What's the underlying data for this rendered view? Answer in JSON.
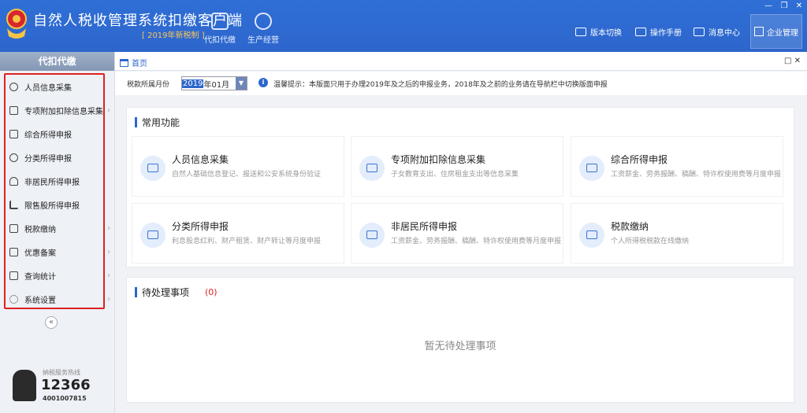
{
  "app": {
    "title": "自然人税收管理系统扣缴客户端",
    "subtitle": "[ 2019年新税制 ]"
  },
  "topnav": [
    {
      "label": "代扣代缴",
      "icon": "wallet-icon"
    },
    {
      "label": "生产经营",
      "icon": "coins-icon"
    }
  ],
  "toplinks": [
    {
      "label": "版本切换",
      "icon": "layers-icon"
    },
    {
      "label": "操作手册",
      "icon": "book-icon"
    },
    {
      "label": "消息中心",
      "icon": "mail-icon"
    }
  ],
  "enterprise_label": "企业管理",
  "window_controls": {
    "minimize": "—",
    "restore": "❐",
    "close": "✕"
  },
  "sidebar": {
    "header": "代扣代缴",
    "items": [
      {
        "label": "人员信息采集",
        "icon": "person-icon"
      },
      {
        "label": "专项附加扣除信息采集",
        "icon": "list-icon"
      },
      {
        "label": "综合所得申报",
        "icon": "stack-icon"
      },
      {
        "label": "分类所得申报",
        "icon": "pie-icon"
      },
      {
        "label": "非居民所得申报",
        "icon": "person-outline-icon"
      },
      {
        "label": "限售股所得申报",
        "icon": "bar-chart-icon"
      },
      {
        "label": "税款缴纳",
        "icon": "folder-icon"
      },
      {
        "label": "优惠备案",
        "icon": "copy-icon"
      },
      {
        "label": "查询统计",
        "icon": "search-list-icon"
      },
      {
        "label": "系统设置",
        "icon": "gear-icon"
      }
    ],
    "collapse": "«",
    "hotline": {
      "label": "纳税服务热线",
      "number": "12366",
      "sub": "4001007815"
    }
  },
  "tab": {
    "home": "首页",
    "controls": "□ ✕"
  },
  "filter": {
    "label": "税款所属月份",
    "month_year": "2019",
    "month_rest": "年01月",
    "tip_icon": "i",
    "tip": "温馨提示：本版面只用于办理2019年及之后的申报业务，2018年及之前的业务请在导航栏中切换版面申报"
  },
  "common": {
    "title": "常用功能",
    "cards": [
      {
        "title": "人员信息采集",
        "desc": "自然人基础信息登记、报送和公安系统身份验证",
        "icon": "id-card-icon"
      },
      {
        "title": "专项附加扣除信息采集",
        "desc": "子女教育支出、住房租金支出等信息采集",
        "icon": "calendar-icon"
      },
      {
        "title": "综合所得申报",
        "desc": "工资薪金、劳务报酬、稿酬、特许权使用费等月度申报",
        "icon": "document-icon"
      },
      {
        "title": "分类所得申报",
        "desc": "利息股息红利、财产租赁、财产转让等月度申报",
        "icon": "edit-icon"
      },
      {
        "title": "非居民所得申报",
        "desc": "工资薪金、劳务报酬、稿酬、特许权使用费等月度申报",
        "icon": "edit-icon"
      },
      {
        "title": "税款缴纳",
        "desc": "个人所得税税款在线缴纳",
        "icon": "payment-icon"
      }
    ]
  },
  "pending": {
    "title": "待处理事项",
    "count": "(0)",
    "empty": "暂无待处理事项"
  },
  "colors": {
    "primary": "#2d66cc",
    "highlight": "#e02020",
    "subtitle": "#ffc75a"
  }
}
